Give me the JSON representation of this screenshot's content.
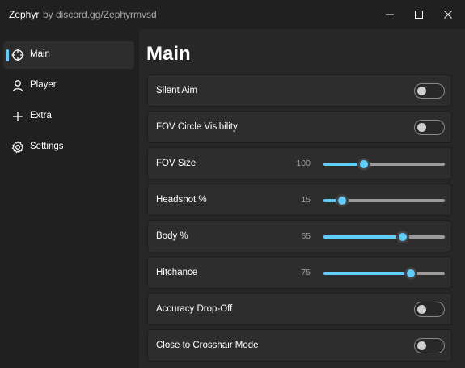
{
  "window": {
    "app_name": "Zephyr",
    "subtitle": "by discord.gg/Zephyrmvsd",
    "controls": [
      "minimize-icon",
      "maximize-icon",
      "close-icon"
    ]
  },
  "sidebar": {
    "items": [
      {
        "label": "Main",
        "icon": "crosshair-icon",
        "active": true
      },
      {
        "label": "Player",
        "icon": "person-icon",
        "active": false
      },
      {
        "label": "Extra",
        "icon": "plus-icon",
        "active": false
      },
      {
        "label": "Settings",
        "icon": "gear-icon",
        "active": false
      }
    ]
  },
  "main": {
    "title": "Main",
    "settings": [
      {
        "label": "Silent Aim",
        "type": "toggle",
        "on": false
      },
      {
        "label": "FOV Circle Visibility",
        "type": "toggle",
        "on": false
      },
      {
        "label": "FOV Size",
        "type": "slider",
        "value": "100",
        "fraction": 0.33
      },
      {
        "label": "Headshot %",
        "type": "slider",
        "value": "15",
        "fraction": 0.15
      },
      {
        "label": "Body %",
        "type": "slider",
        "value": "65",
        "fraction": 0.65
      },
      {
        "label": "Hitchance",
        "type": "slider",
        "value": "75",
        "fraction": 0.72
      },
      {
        "label": "Accuracy Drop-Off",
        "type": "toggle",
        "on": false
      },
      {
        "label": "Close to Crosshair Mode",
        "type": "toggle",
        "on": false
      }
    ]
  },
  "colors": {
    "accent": "#60cdff",
    "window_bg": "#202020",
    "content_bg": "#272727",
    "card_bg": "#2d2d2d"
  }
}
